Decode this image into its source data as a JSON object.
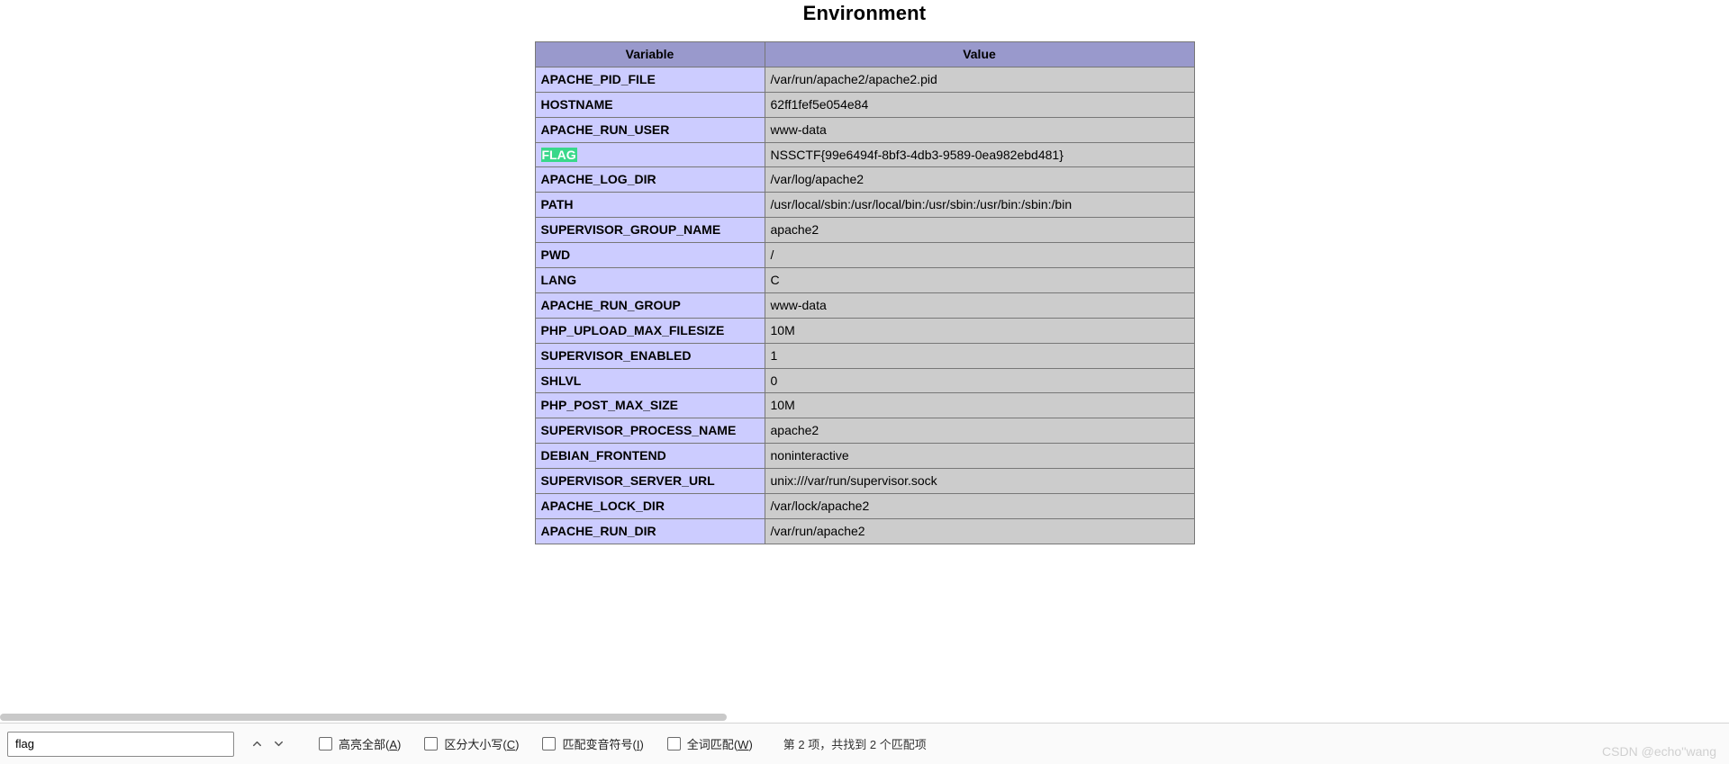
{
  "title": "Environment",
  "columns": {
    "variable": "Variable",
    "value": "Value"
  },
  "highlight_var": "FLAG",
  "rows": [
    {
      "variable": "APACHE_PID_FILE",
      "value": "/var/run/apache2/apache2.pid"
    },
    {
      "variable": "HOSTNAME",
      "value": "62ff1fef5e054e84"
    },
    {
      "variable": "APACHE_RUN_USER",
      "value": "www-data"
    },
    {
      "variable": "FLAG",
      "value": "NSSCTF{99e6494f-8bf3-4db3-9589-0ea982ebd481}"
    },
    {
      "variable": "APACHE_LOG_DIR",
      "value": "/var/log/apache2"
    },
    {
      "variable": "PATH",
      "value": "/usr/local/sbin:/usr/local/bin:/usr/sbin:/usr/bin:/sbin:/bin"
    },
    {
      "variable": "SUPERVISOR_GROUP_NAME",
      "value": "apache2"
    },
    {
      "variable": "PWD",
      "value": "/"
    },
    {
      "variable": "LANG",
      "value": "C"
    },
    {
      "variable": "APACHE_RUN_GROUP",
      "value": "www-data"
    },
    {
      "variable": "PHP_UPLOAD_MAX_FILESIZE",
      "value": "10M"
    },
    {
      "variable": "SUPERVISOR_ENABLED",
      "value": "1"
    },
    {
      "variable": "SHLVL",
      "value": "0"
    },
    {
      "variable": "PHP_POST_MAX_SIZE",
      "value": "10M"
    },
    {
      "variable": "SUPERVISOR_PROCESS_NAME",
      "value": "apache2"
    },
    {
      "variable": "DEBIAN_FRONTEND",
      "value": "noninteractive"
    },
    {
      "variable": "SUPERVISOR_SERVER_URL",
      "value": "unix:///var/run/supervisor.sock"
    },
    {
      "variable": "APACHE_LOCK_DIR",
      "value": "/var/lock/apache2"
    },
    {
      "variable": "APACHE_RUN_DIR",
      "value": "/var/run/apache2"
    }
  ],
  "findbar": {
    "query": "flag",
    "highlight_all": "高亮全部",
    "highlight_all_key": "A",
    "match_case": "区分大小写",
    "match_case_key": "C",
    "match_diacritics": "匹配变音符号",
    "match_diacritics_key": "I",
    "whole_word": "全词匹配",
    "whole_word_key": "W",
    "results": "第 2 项，共找到 2 个匹配项"
  },
  "watermark": "CSDN @echo''wang"
}
